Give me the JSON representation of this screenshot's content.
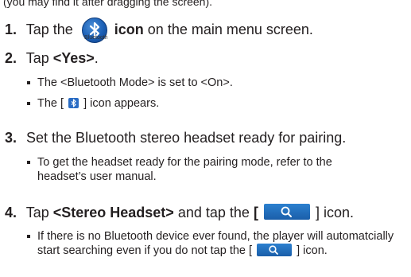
{
  "intro": {
    "fragment": "(you may find it after dragging the screen)."
  },
  "steps": [
    {
      "num": "1.",
      "pre": "Tap the",
      "icon_caption": "Bluetooth",
      "bold": "icon",
      "post": "on the main menu screen."
    },
    {
      "num": "2.",
      "pre": "Tap",
      "bold": "<Yes>",
      "post": ".",
      "bullets": [
        "The <Bluetooth Mode> is set to <On>.",
        {
          "pre": "The [",
          "post": "] icon appears."
        }
      ]
    },
    {
      "num": "3.",
      "text": "Set the Bluetooth stereo headset ready for pairing.",
      "bullets": [
        "To get the headset ready for the pairing mode, refer to the headset’s user manual."
      ]
    },
    {
      "num": "4.",
      "pre": "Tap",
      "bold": "<Stereo Headset>",
      "mid": "and tap the",
      "bold2": "[",
      "post": "] icon.",
      "bullets": [
        {
          "text": "If there is no Bluetooth device ever found, the player will automatcially start searching even if you do not tap the",
          "end_pre": "[",
          "end_post": "] icon."
        }
      ]
    }
  ],
  "icons": {
    "bluetooth": "bluetooth-icon",
    "search": "search-icon",
    "brand_color": "#1b5fb5"
  }
}
